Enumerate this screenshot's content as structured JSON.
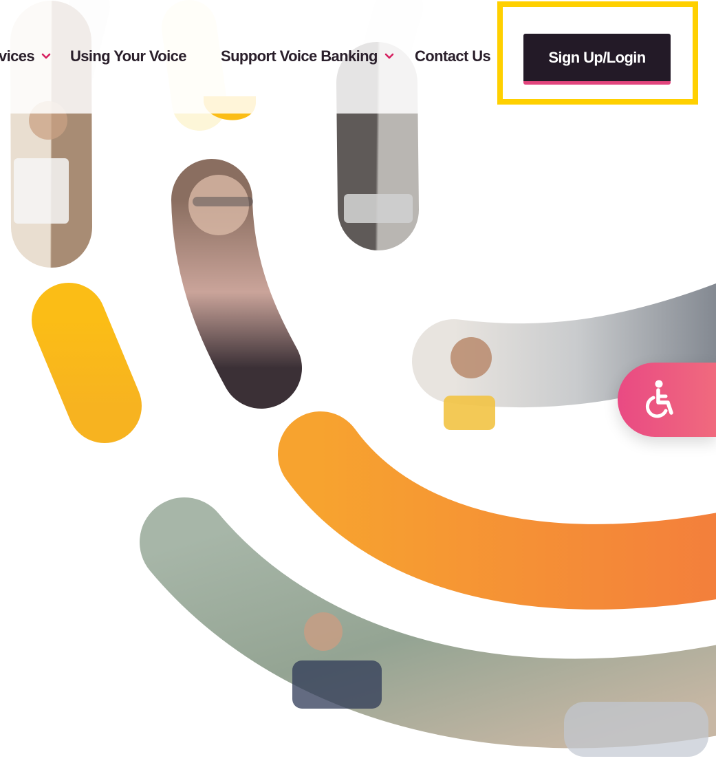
{
  "nav": {
    "items": [
      {
        "label": "vices",
        "has_dropdown": true
      },
      {
        "label": "Using Your Voice",
        "has_dropdown": false
      },
      {
        "label": "Support Voice Banking",
        "has_dropdown": true
      },
      {
        "label": "Contact Us",
        "has_dropdown": false
      }
    ],
    "signup_label": "Sign Up/Login"
  },
  "icons": {
    "dropdown": "chevron-down-icon",
    "accessibility": "wheelchair-icon"
  },
  "colors": {
    "nav_text": "#2a1f2b",
    "chevron": "#d61f5f",
    "signup_bg": "#231a27",
    "signup_underline": "#e2457d",
    "highlight": "#ffd000",
    "accent_pink": "#e94a83",
    "accent_yellow": "#fbbc16",
    "accent_orange": "#f5953a"
  }
}
